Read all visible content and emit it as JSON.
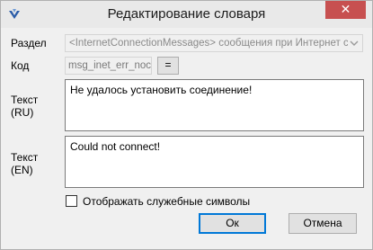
{
  "window": {
    "title": "Редактирование словаря",
    "close_label": "✕"
  },
  "form": {
    "section_label": "Раздел",
    "section_value": "<InternetConnectionMessages> сообщения при Интернет соед",
    "code_label": "Код",
    "code_value": "msg_inet_err_noco",
    "code_button_label": "=",
    "text_ru_label_1": "Текст",
    "text_ru_label_2": "(RU)",
    "text_ru_value": "Не удалось установить соединение!",
    "text_en_label_1": "Текст",
    "text_en_label_2": "(EN)",
    "text_en_value": "Could not connect!",
    "show_symbols_label": "Отображать служебные символы",
    "show_symbols_checked": false
  },
  "buttons": {
    "ok_label": "Ок",
    "cancel_label": "Отмена"
  },
  "colors": {
    "close_button": "#c75050",
    "default_button_border": "#0078d7"
  }
}
